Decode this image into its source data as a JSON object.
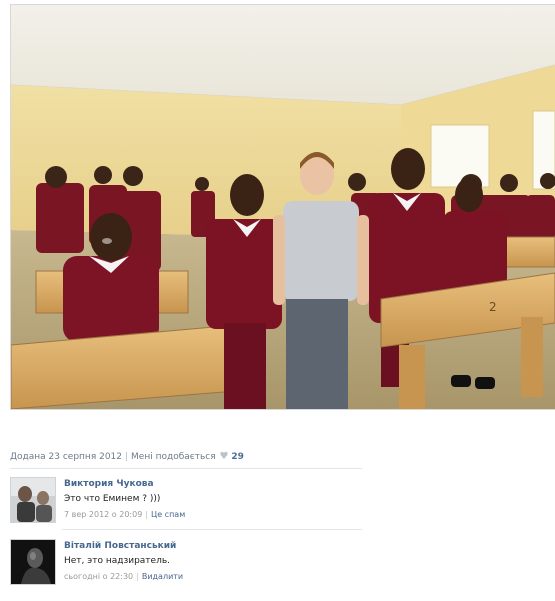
{
  "post": {
    "added_label": "Додана 23 серпня 2012",
    "like_label": "Мені подобається",
    "like_icon": "heart-icon",
    "like_count": "29"
  },
  "comments": [
    {
      "author": "Виктория Чукова",
      "text": "Это что Еминем ? )))",
      "timestamp": "7 вер 2012 о 20:09",
      "action": "Це спам"
    },
    {
      "author": "Віталій Повстанський",
      "text": "Нет, это надзиратель.",
      "timestamp": "сьогодні о 22:30",
      "action": "Видалити"
    }
  ],
  "colors": {
    "link": "#45688e",
    "meta": "#6c7b8b",
    "uniform": "#7a1624"
  }
}
